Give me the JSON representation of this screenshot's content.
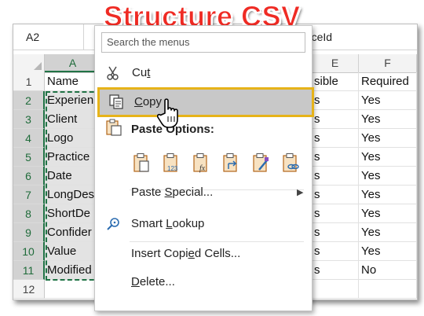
{
  "title": "Structure CSV",
  "formula_bar": {
    "name_box": "A2",
    "formula_text": "enceId"
  },
  "columns": [
    "A",
    "E",
    "F"
  ],
  "rows": [
    {
      "n": "1",
      "a": "Name",
      "e": "sible",
      "f": "Required"
    },
    {
      "n": "2",
      "a": "Experien",
      "e": "s",
      "f": "Yes"
    },
    {
      "n": "3",
      "a": "Client",
      "e": "s",
      "f": "Yes"
    },
    {
      "n": "4",
      "a": "Logo",
      "e": "s",
      "f": "Yes"
    },
    {
      "n": "5",
      "a": "Practice",
      "e": "s",
      "f": "Yes"
    },
    {
      "n": "6",
      "a": "Date",
      "e": "s",
      "f": "Yes"
    },
    {
      "n": "7",
      "a": "LongDes",
      "e": "s",
      "f": "Yes"
    },
    {
      "n": "8",
      "a": "ShortDe",
      "e": "s",
      "f": "Yes"
    },
    {
      "n": "9",
      "a": "Confider",
      "e": "s",
      "f": "Yes"
    },
    {
      "n": "10",
      "a": "Value",
      "e": "s",
      "f": "Yes"
    },
    {
      "n": "11",
      "a": "Modified",
      "e": "s",
      "f": "No"
    },
    {
      "n": "12",
      "a": "",
      "e": "",
      "f": ""
    }
  ],
  "menu": {
    "search_placeholder": "Search the menus",
    "cut": {
      "pre": "Cu",
      "key": "t",
      "post": ""
    },
    "copy": {
      "pre": "",
      "key": "C",
      "post": "opy"
    },
    "paste_options": "Paste Options:",
    "paste_icons": [
      "paste-icon",
      "paste-values-icon",
      "paste-formulas-icon",
      "paste-transpose-icon",
      "paste-formatting-icon",
      "paste-link-icon"
    ],
    "paste_special": {
      "pre": "Paste ",
      "key": "S",
      "post": "pecial..."
    },
    "smart_lookup": {
      "pre": "Smart ",
      "key": "L",
      "post": "ookup"
    },
    "insert_copied": {
      "pre": "Insert Copi",
      "key": "e",
      "post": "d Cells..."
    },
    "delete": {
      "pre": "",
      "key": "D",
      "post": "elete..."
    }
  },
  "colors": {
    "accent_green": "#217346",
    "highlight_border": "#e6b319",
    "title_red": "#ef2b24",
    "icon_blue": "#2b6cb0",
    "icon_orange": "#e38b1b"
  }
}
